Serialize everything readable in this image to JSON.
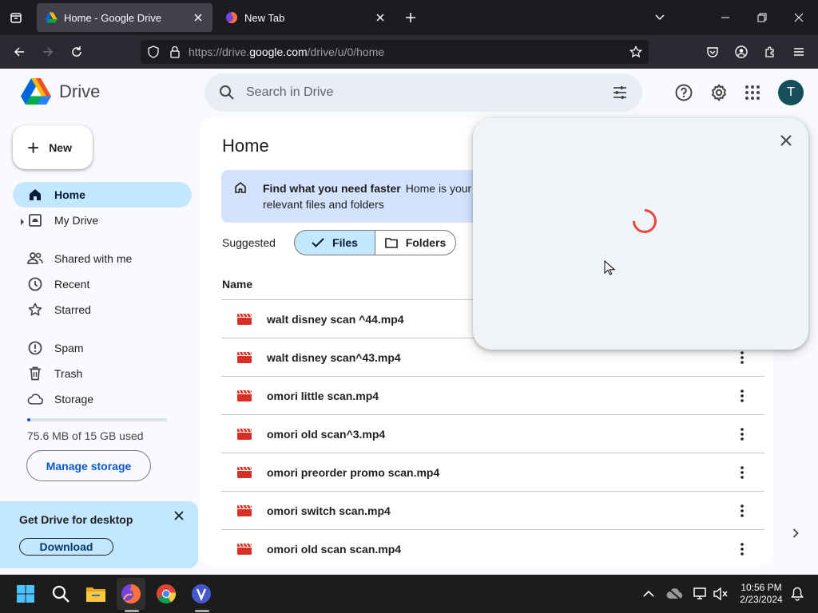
{
  "browser": {
    "tabs": [
      {
        "title": "Home - Google Drive",
        "active": true
      },
      {
        "title": "New Tab",
        "active": false
      }
    ],
    "url_prefix": "https://drive.",
    "url_domain": "google.com",
    "url_path": "/drive/u/0/home"
  },
  "header": {
    "app_name": "Drive",
    "search_placeholder": "Search in Drive",
    "avatar_initial": "T"
  },
  "sidebar": {
    "new_label": "New",
    "items": [
      {
        "label": "Home",
        "icon": "home-icon",
        "active": true
      },
      {
        "label": "My Drive",
        "icon": "my-drive-icon"
      },
      {
        "label": "Shared with me",
        "icon": "shared-icon"
      },
      {
        "label": "Recent",
        "icon": "clock-icon"
      },
      {
        "label": "Starred",
        "icon": "star-icon"
      },
      {
        "label": "Spam",
        "icon": "spam-icon"
      },
      {
        "label": "Trash",
        "icon": "trash-icon"
      },
      {
        "label": "Storage",
        "icon": "cloud-icon"
      }
    ],
    "storage_used_fraction": 0.005,
    "storage_text": "75.6 MB of 15 GB used",
    "manage_label": "Manage storage",
    "promo_title": "Get Drive for desktop",
    "promo_button": "Download"
  },
  "main": {
    "title": "Home",
    "banner_title": "Find what you need faster",
    "banner_text_1": "Home is your",
    "banner_text_2": "relevant files and folders",
    "suggested_label": "Suggested",
    "chip_files": "Files",
    "chip_folders": "Folders",
    "column_name": "Name",
    "files": [
      "walt disney scan ^44.mp4",
      "walt disney scan^43.mp4",
      "omori little scan.mp4",
      "omori old scan^3.mp4",
      "omori preorder promo scan.mp4",
      "omori switch scan.mp4",
      "omori old scan scan.mp4"
    ]
  },
  "taskbar": {
    "time": "10:56 PM",
    "date": "2/23/2024"
  },
  "colors": {
    "accent": "#0b57d0",
    "selected": "#c2e7ff",
    "video_icon": "#d93025"
  }
}
